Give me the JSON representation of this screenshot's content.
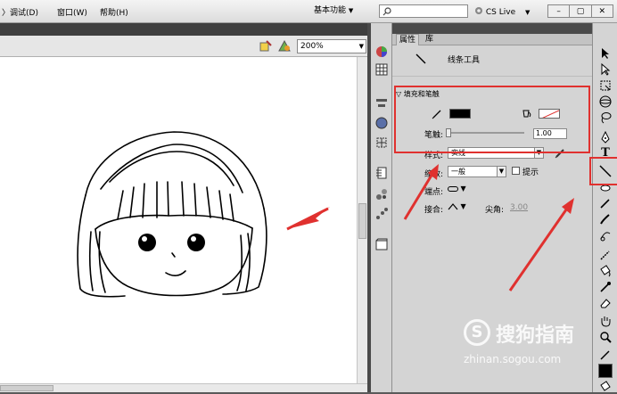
{
  "menu": {
    "items": [
      "〉调试(D)",
      "窗口(W)",
      "帮助(H)"
    ],
    "workspace": "基本功能",
    "search_placeholder": "",
    "cs_live": "CS Live"
  },
  "editbar": {
    "zoom": "200%"
  },
  "properties": {
    "tabs": [
      "属性",
      "库"
    ],
    "tool_name": "线条工具",
    "section_title": "填充和笔触",
    "stroke_label": "笔触:",
    "stroke_value": "1.00",
    "style_label": "样式:",
    "style_value": "实线",
    "scale_label": "缩放:",
    "scale_value": "一般",
    "hint_label": "提示",
    "cap_label": "端点:",
    "join_label": "接合:",
    "miter_label": "尖角:",
    "miter_value": "3.00"
  },
  "colors": {
    "highlight": "#e0312f",
    "stroke_color": "#000000"
  },
  "watermark": {
    "text": "搜狗指南",
    "url": "zhinan.sogou.com",
    "logo_letter": "S"
  }
}
